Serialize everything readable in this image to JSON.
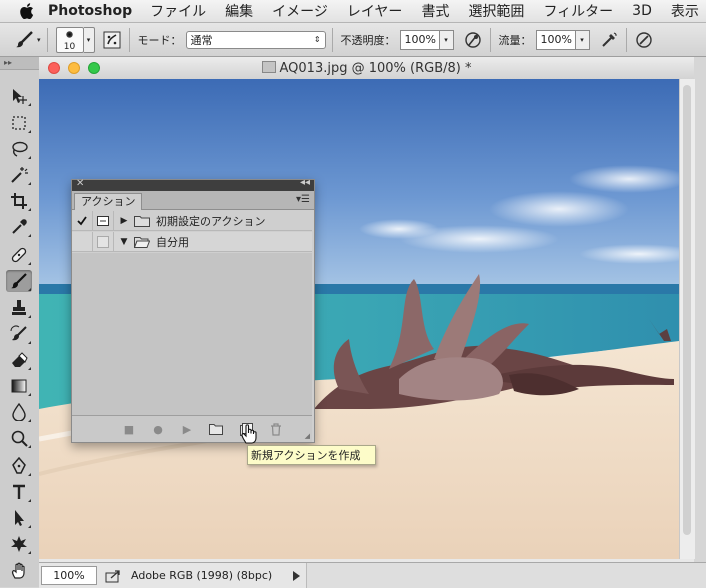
{
  "menubar": {
    "app_name": "Photoshop",
    "items": [
      "ファイル",
      "編集",
      "イメージ",
      "レイヤー",
      "書式",
      "選択範囲",
      "フィルター",
      "3D",
      "表示"
    ]
  },
  "options": {
    "brush_size": "10",
    "mode_label": "モード：",
    "mode_value": "通常",
    "opacity_label": "不透明度：",
    "opacity_value": "100%",
    "flow_label": "流量：",
    "flow_value": "100%"
  },
  "document": {
    "title": "AQ013.jpg @ 100% (RGB/8) *"
  },
  "status": {
    "zoom": "100%",
    "profile": "Adobe RGB (1998) (8bpc)"
  },
  "actions_panel": {
    "tab_label": "アクション",
    "rows": [
      {
        "label": "初期設定のアクション",
        "checked": true,
        "expanded": false
      },
      {
        "label": "自分用",
        "checked": false,
        "expanded": true
      }
    ]
  },
  "tooltip": {
    "text": "新規アクションを作成"
  },
  "colors": {
    "sky_top": "#3e6fb7",
    "sea": "#3aa7b0",
    "sand": "#f0ddc7"
  }
}
